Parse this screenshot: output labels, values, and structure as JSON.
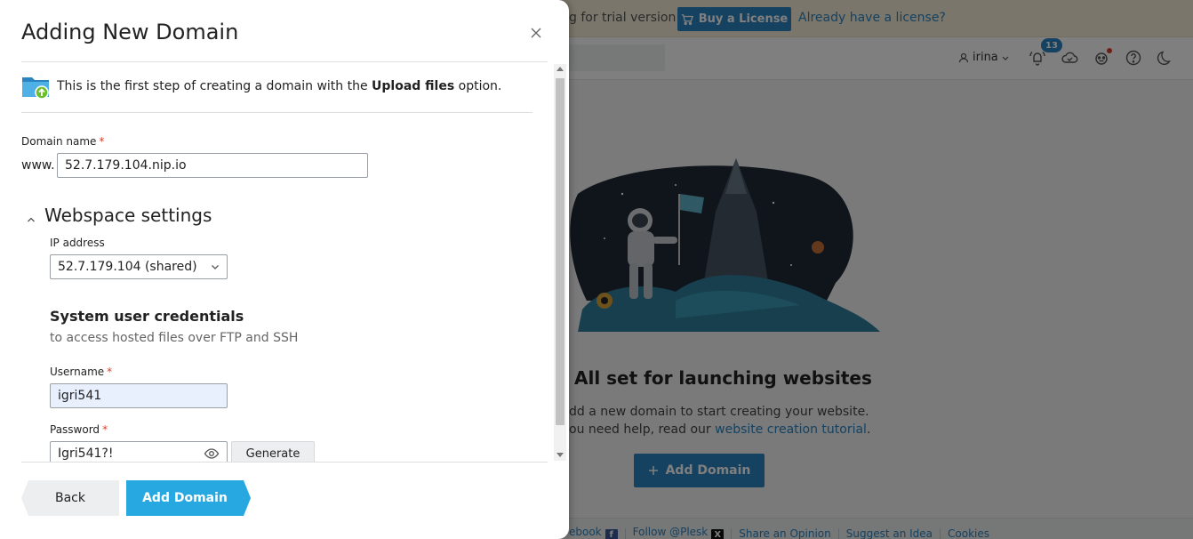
{
  "background": {
    "trial_text": "g for trial version",
    "buy_license_label": "Buy a License",
    "already_license_link": "Already have a license?",
    "user_name": "irina",
    "notification_count": "13",
    "empty_state": {
      "title": "All set for launching websites",
      "line1": "dd a new domain to start creating your website.",
      "line2_prefix": "ou need help, read our ",
      "line2_link": "website creation tutorial",
      "line2_suffix": ".",
      "add_domain_label": "Add Domain"
    },
    "footer": {
      "facebook": "ebook",
      "follow": "Follow @Plesk",
      "share": "Share an Opinion",
      "suggest": "Suggest an Idea",
      "cookies": "Cookies"
    }
  },
  "dialog": {
    "title": "Adding New Domain",
    "info_prefix": "This is the first step of creating a domain with the ",
    "info_bold": "Upload files",
    "info_suffix": " option.",
    "domain_name_label": "Domain name",
    "required_mark": "*",
    "www_prefix": "www.",
    "domain_name_value": "52.7.179.104.nip.io",
    "webspace_section_title": "Webspace settings",
    "ip_address_label": "IP address",
    "ip_address_value": "52.7.179.104 (shared)",
    "credentials_title": "System user credentials",
    "credentials_desc": "to access hosted files over FTP and SSH",
    "username_label": "Username",
    "username_value": "igri541",
    "password_label": "Password",
    "password_value": "Igri541?!",
    "generate_label": "Generate",
    "back_label": "Back",
    "add_domain_label": "Add Domain"
  },
  "colors": {
    "accent": "#28a8e0",
    "link": "#2a84c2",
    "required": "#d9412b",
    "trial_bar": "#f6ecd7"
  },
  "icons": {
    "close": "close-icon",
    "folder": "folder-upload-icon",
    "chevron": "chevron-up-icon",
    "select": "chevron-down-icon",
    "eye": "eye-icon"
  }
}
